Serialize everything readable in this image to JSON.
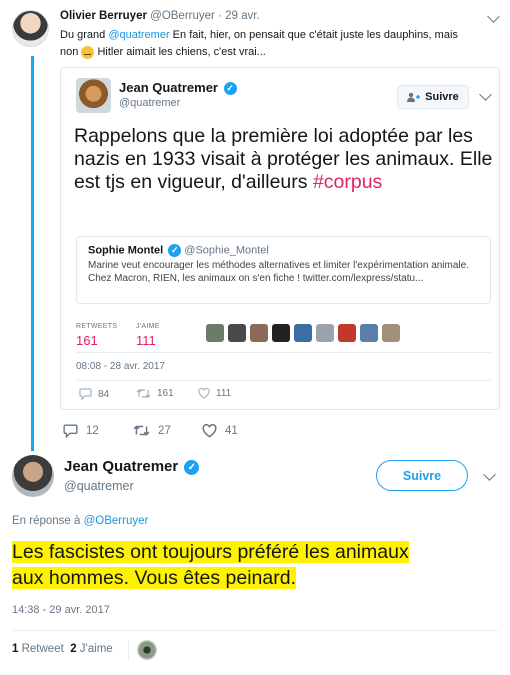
{
  "first_tweet": {
    "author_name": "Olivier Berruyer",
    "author_handle": "@OBerruyer",
    "time": "29 avr.",
    "text_before_mention": "Du grand ",
    "mention": "@quatremer",
    "text_after_mention": " En fait, hier, on pensait que c'était juste les dauphins, mais",
    "text_line2_start": "non ",
    "text_line2_end": " Hitler aimait les chiens, c'est vrai...",
    "actions": {
      "replies": "12",
      "retweets": "27",
      "likes": "41"
    }
  },
  "quoted_tweet": {
    "author_name": "Jean Quatremer",
    "author_handle": "@quatremer",
    "follow_label": "Suivre",
    "text": "Rappelons que la première loi adoptée par les nazis en 1933 visait à protéger les animaux. Elle est tjs en vigueur, d'ailleurs",
    "hashtag": "#corpus",
    "inner_quote": {
      "author_name": "Sophie Montel",
      "author_handle": "@Sophie_Montel",
      "text": "Marine veut encourager les méthodes alternatives et limiter l'expérimentation animale. Chez Macron, RIEN, les animaux on s'en fiche ! twitter.com/lexpress/statu..."
    },
    "stats": {
      "retweets_label": "RETWEETS",
      "retweets": "161",
      "likes_label": "J'AIME",
      "likes": "111"
    },
    "timestamp": "08:08 - 28 avr. 2017",
    "actions": {
      "replies": "84",
      "retweets": "161",
      "likes": "111"
    }
  },
  "main_tweet": {
    "author_name": "Jean Quatremer",
    "author_handle": "@quatremer",
    "follow_label": "Suivre",
    "reply_prefix": "En réponse à ",
    "reply_handle": "@OBerruyer",
    "text_line1": "Les fascistes ont toujours préféré les animaux",
    "text_line2": "aux hommes. Vous êtes peinard.",
    "timestamp": "14:38 - 29 avr. 2017",
    "retweet_count": "1",
    "retweet_label": "Retweet",
    "like_count": "2",
    "like_label": "J'aime"
  },
  "colors": {
    "accent": "#1da1f2",
    "link": "#1b95e0",
    "highlight": "#fff200",
    "stat": "#e0245e"
  },
  "icons": [
    "reply-icon",
    "retweet-icon",
    "heart-icon",
    "chevron-down-icon",
    "verified-icon",
    "follow-person-icon"
  ]
}
